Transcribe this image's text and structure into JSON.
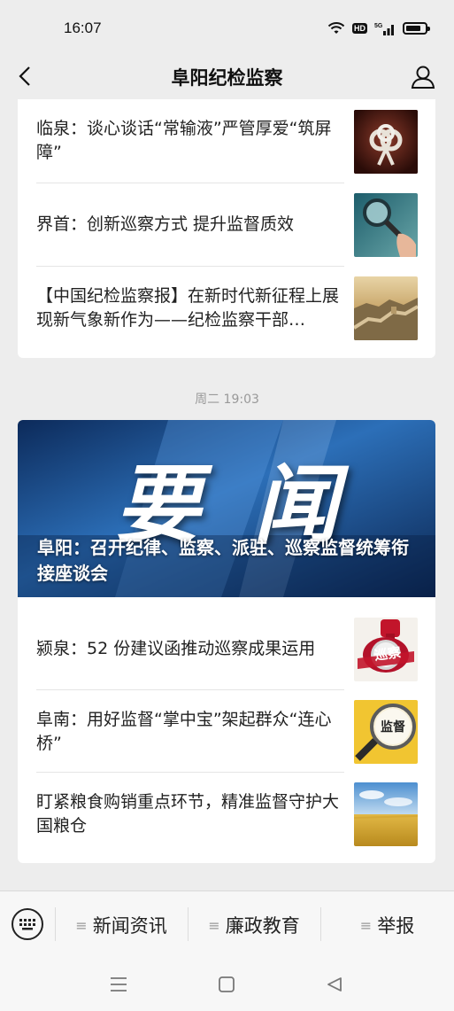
{
  "status_bar": {
    "time": "16:07",
    "hd": "HD",
    "network": "5G"
  },
  "header": {
    "title": "阜阳纪检监察"
  },
  "card1": {
    "items": [
      {
        "title": "临泉：谈心谈话“常输液”严管厚爱“筑屏障”",
        "thumb_icon": "knot-image"
      },
      {
        "title": "界首：创新巡察方式 提升监督质效",
        "thumb_icon": "magnifier-image"
      },
      {
        "title": "【中国纪检监察报】在新时代新征程上展现新气象新作为——纪检监察干部…",
        "thumb_icon": "great-wall-image"
      }
    ]
  },
  "timestamp": "周二 19:03",
  "card2": {
    "banner": {
      "art_text": "要闻",
      "caption": "阜阳：召开纪律、监察、派驻、巡察监督统筹衔接座谈会"
    },
    "items": [
      {
        "title": "颍泉：52 份建议函推动巡察成果运用",
        "thumb_icon": "inspection-stamp-image",
        "thumb_text": "巡察"
      },
      {
        "title": "阜南：用好监督“掌中宝”架起群众“连心桥”",
        "thumb_icon": "supervision-magnifier-image",
        "thumb_text": "监督"
      },
      {
        "title": "盯紧粮食购销重点环节，精准监督守护大国粮仓",
        "thumb_icon": "wheat-field-image"
      }
    ]
  },
  "menu": {
    "items": [
      {
        "label": "新闻资讯"
      },
      {
        "label": "廉政教育"
      },
      {
        "label": "举报"
      }
    ]
  },
  "colors": {
    "background": "#ededed",
    "banner_blue": "#1b4e8f",
    "card": "#ffffff"
  }
}
